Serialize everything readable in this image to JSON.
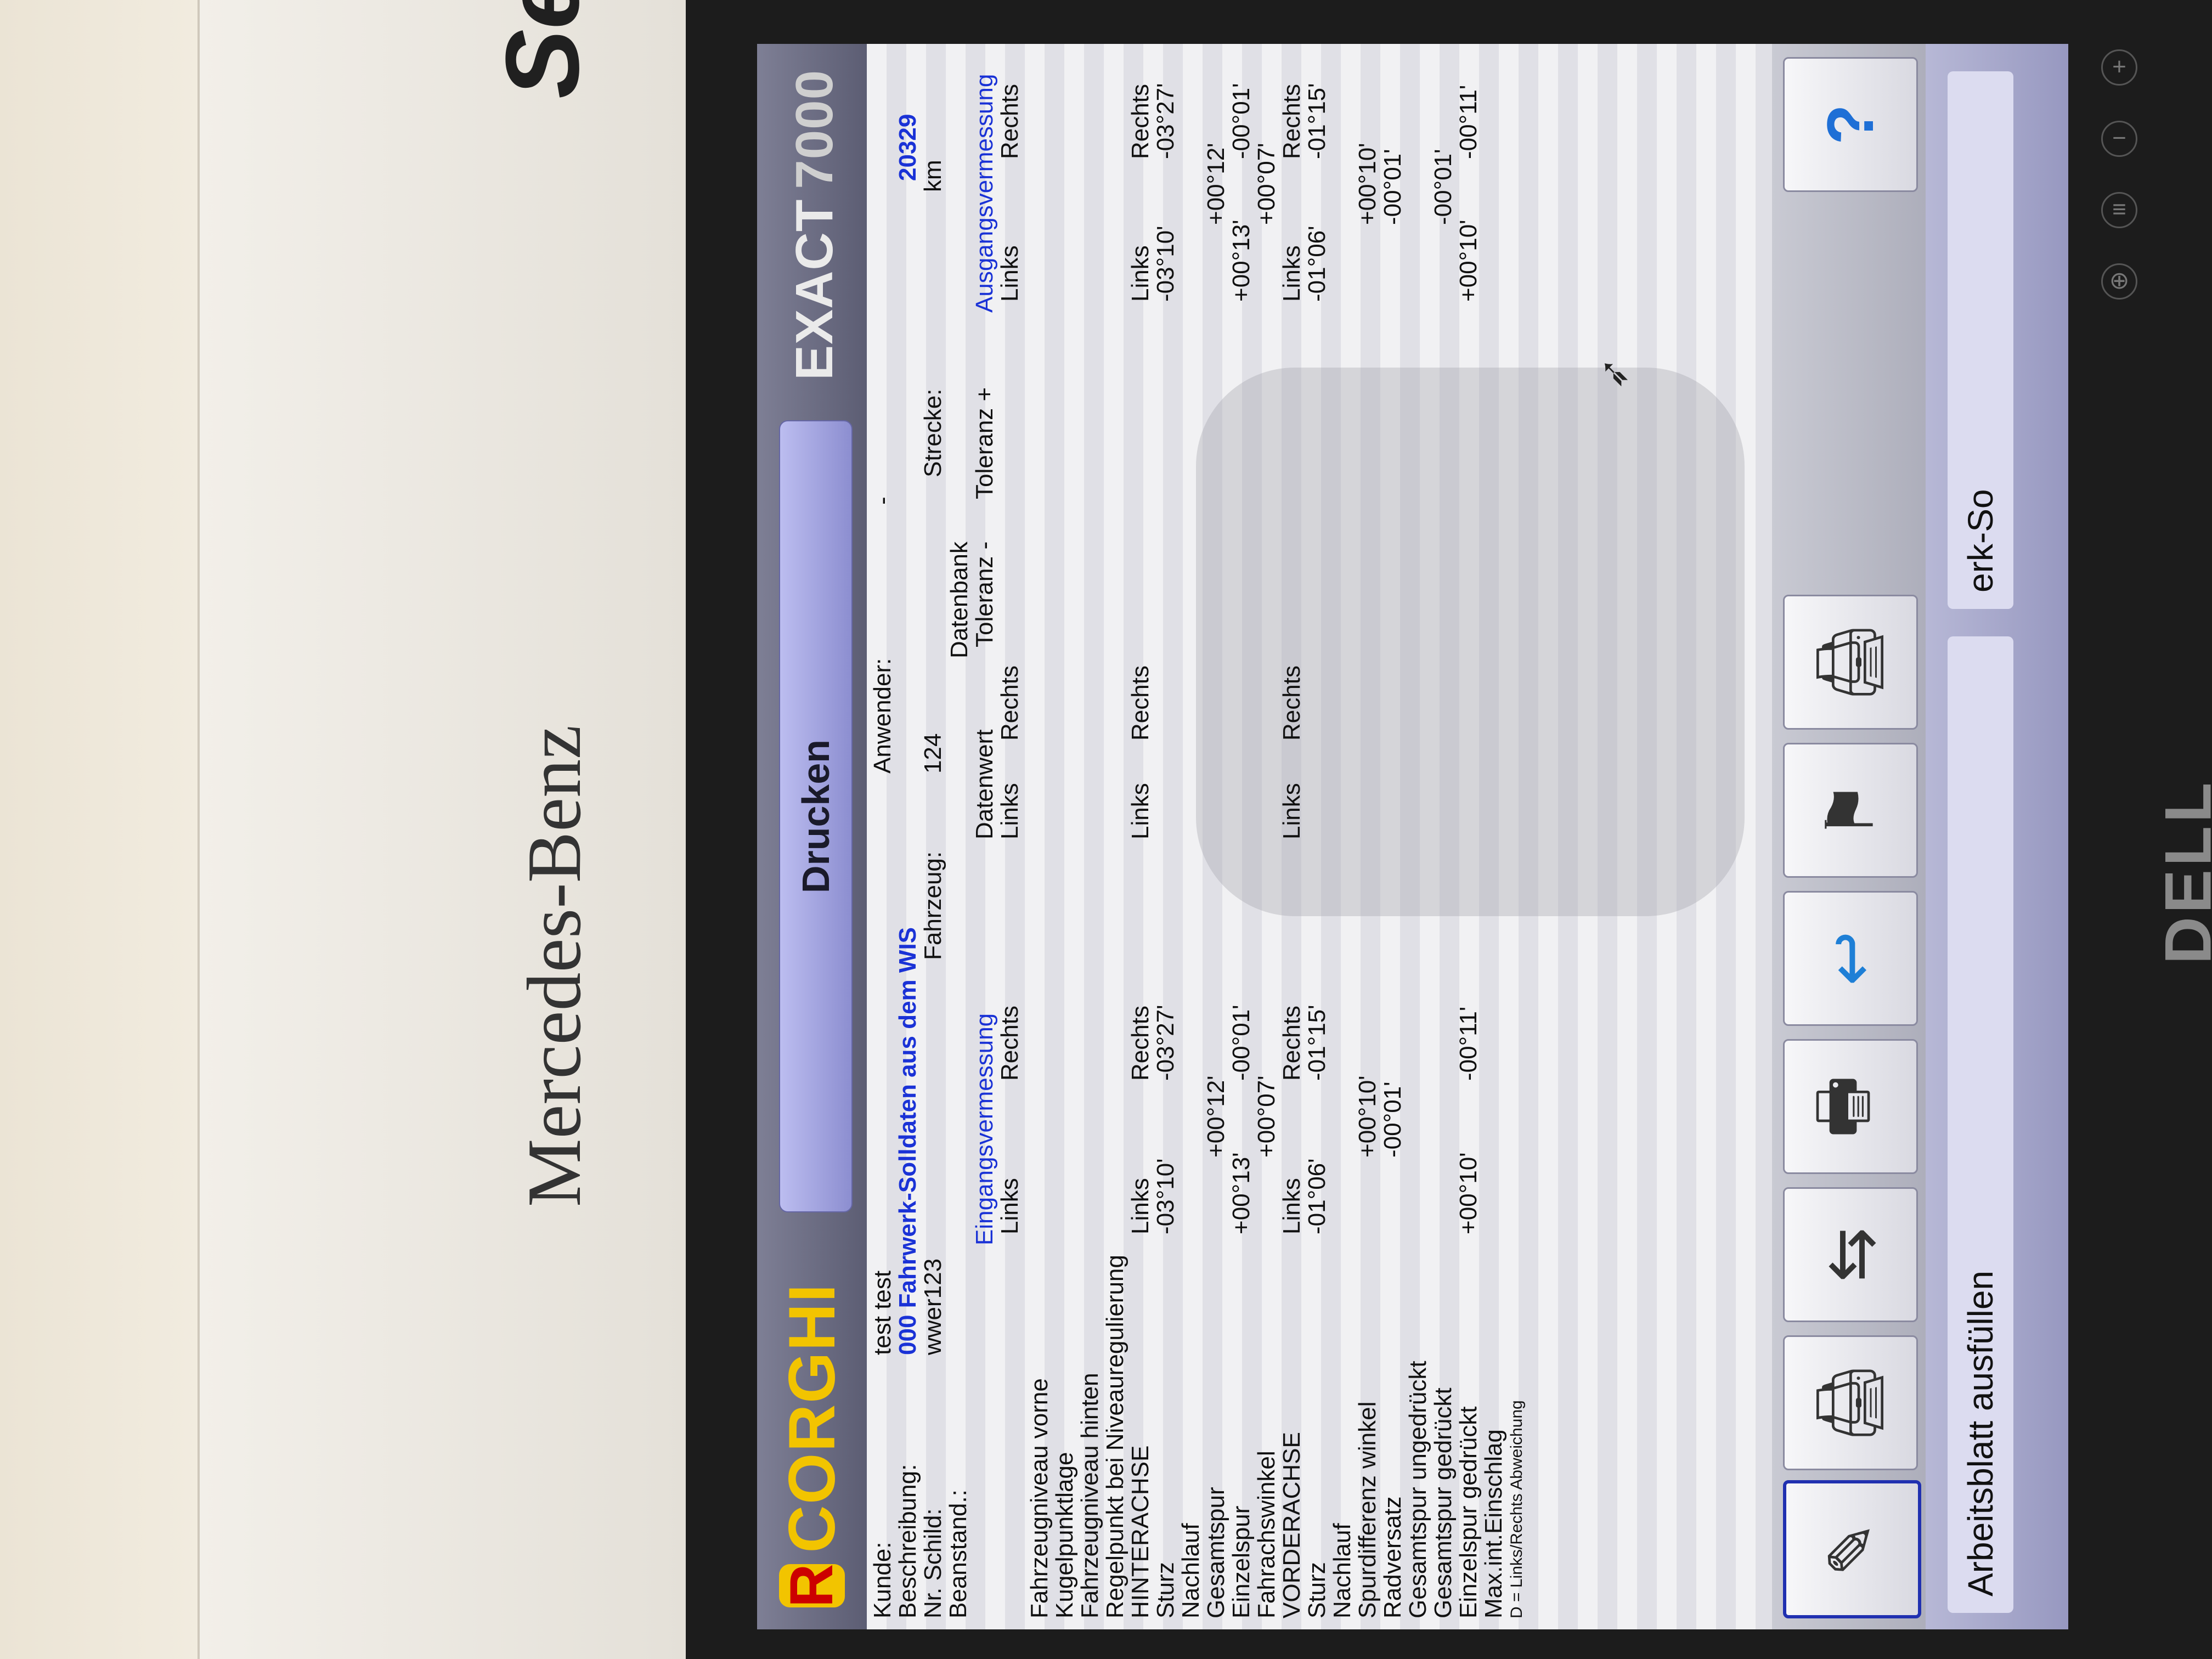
{
  "app": {
    "logo_text": "CORGHI",
    "title_button": "Drucken",
    "product": "EXACT",
    "product_number": "7000"
  },
  "header": {
    "kunde_label": "Kunde:",
    "kunde_value": "test test",
    "beschreibung_label": "Beschreibung:",
    "beschreibung_value": "000 Fahrwerk-Solldaten aus dem WIS",
    "beschreibung_code": "20329",
    "nr_schild_label": "Nr. Schild:",
    "nr_schild_value": "wwer123",
    "fahrzeug_label": "Fahrzeug:",
    "fahrzeug_value": "124",
    "strecke_label": "Strecke:",
    "strecke_unit": "km",
    "anwender_label": "Anwender:",
    "anwender_value": "-",
    "beanstand_label": "Beanstand.:"
  },
  "columns": {
    "eingang": "Eingangsvermessung",
    "datenbank": "Datenbank",
    "datenwert": "Datenwert",
    "toleranz_minus": "Toleranz -",
    "toleranz_plus": "Toleranz +",
    "ausgang": "Ausgangsvermessung",
    "links": "Links",
    "rechts": "Rechts"
  },
  "rows": [
    "Fahrzeugniveau vorne",
    "Kugelpunktlage",
    "Fahrzeugniveau hinten",
    "Regelpunkt bei Niveauregulierung",
    "HINTERACHSE",
    "Sturz",
    "Nachlauf",
    "Gesamtspur",
    "Einzelspur",
    "Fahrachswinkel",
    "VORDERACHSE",
    "Sturz",
    "Nachlauf",
    "Spurdifferenz winkel",
    "Radversatz",
    "Gesamtspur ungedrückt",
    "Gesamtspur gedrückt",
    "Einzelspur gedrückt",
    "Max.int.Einschlag"
  ],
  "values": {
    "ha_sturz_links": "-03°10'",
    "ha_sturz_rechts": "-03°27'",
    "ha_gesamtspur": "+00°12'",
    "ha_einzelspur_links": "+00°13'",
    "ha_einzelspur_rechts": "-00°01'",
    "ha_fahrachswinkel": "+00°07'",
    "va_sturz_links": "-01°06'",
    "va_sturz_rechts": "-01°15'",
    "va_spurdifferenz": "+00°10'",
    "va_radversatz": "-00°01'",
    "va_gesamtspur_gedrueckt": "-00°01'",
    "va_einzelspur_links": "+00°10'",
    "va_einzelspur_rechts": "-00°11'"
  },
  "footnote": "D = Links/Rechts Abweichung",
  "toolbar": {
    "help": "?"
  },
  "status": {
    "left": "Arbeitsblatt ausfüllen",
    "right": "erk-So"
  },
  "background": {
    "service": "Service",
    "brand": "Mercedes-Benz",
    "monitor": "DELL"
  }
}
